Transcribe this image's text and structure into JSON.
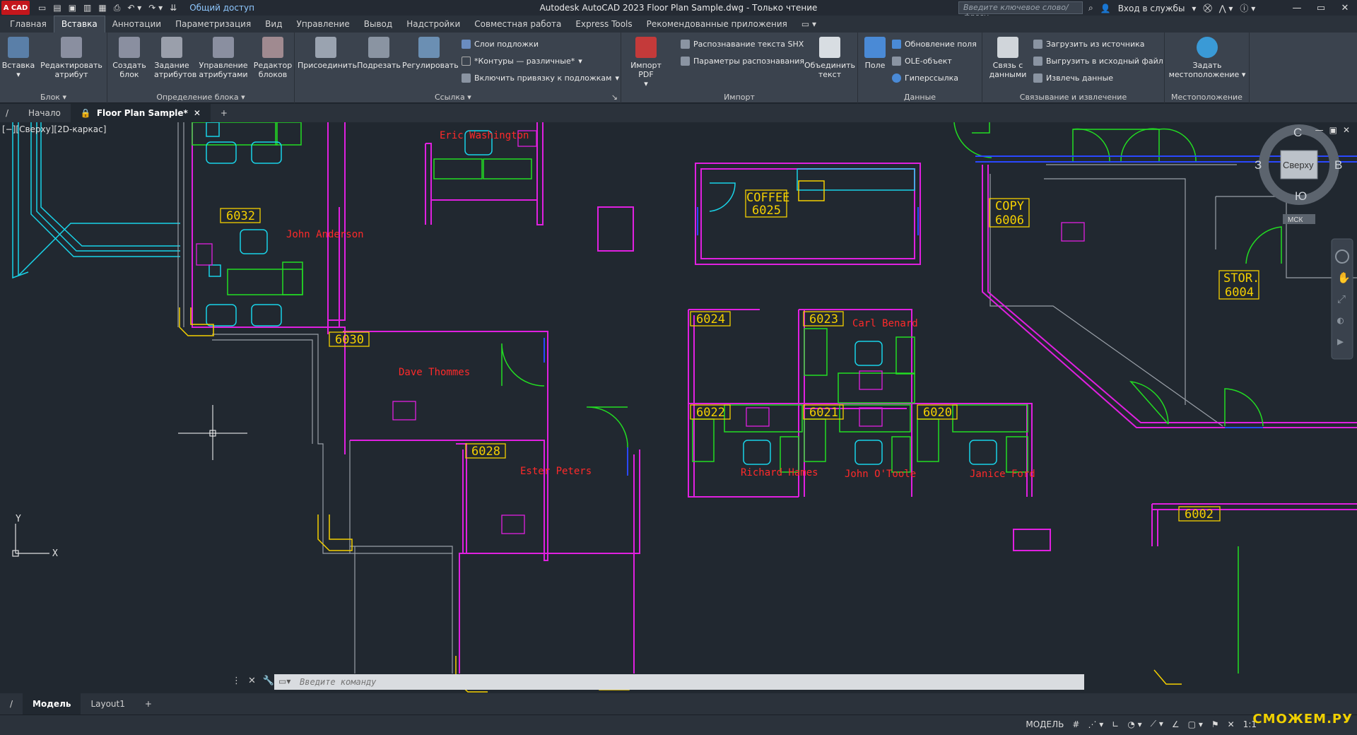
{
  "titlebar": {
    "logo": "A CAD",
    "share": "Общий доступ",
    "title": "Autodesk AutoCAD 2023    Floor Plan Sample.dwg - Только чтение",
    "search_placeholder": "Введите ключевое слово/фразу",
    "signin": "Вход в службы"
  },
  "ribbon_tabs": [
    "Главная",
    "Вставка",
    "Аннотации",
    "Параметризация",
    "Вид",
    "Управление",
    "Вывод",
    "Надстройки",
    "Совместная работа",
    "Express Tools",
    "Рекомендованные приложения"
  ],
  "active_tab": "Вставка",
  "ribbon": {
    "block_panel": {
      "title": "Блок",
      "insert": "Вставка",
      "edit_attr": "Редактировать атрибут"
    },
    "blockdef_panel": {
      "title": "Определение блока",
      "create": "Создать блок",
      "define_attr": "Задание атрибутов",
      "manage_attr": "Управление атрибутами",
      "block_editor": "Редактор блоков"
    },
    "reference_panel": {
      "title": "Ссылка",
      "attach": "Присоединить",
      "clip": "Подрезать",
      "adjust": "Регулировать",
      "underlay_layers": "Слои подложки",
      "frames": "*Контуры — различные*",
      "snap_underlay": "Включить привязку к подложкам"
    },
    "import_panel": {
      "title": "Импорт",
      "import_pdf": "Импорт PDF",
      "recognize_shx": "Распознавание текста SHX",
      "recognize_params": "Параметры распознавания",
      "combine_text": "Объединить текст"
    },
    "data_panel": {
      "title": "Данные",
      "field": "Поле",
      "update_fields": "Обновление поля",
      "ole": "OLE-объект",
      "hyperlink": "Гиперссылка"
    },
    "link_panel": {
      "title": "Связывание и извлечение",
      "data_link": "Связь с данными",
      "load_source": "Загрузить из источника",
      "upload_source": "Выгрузить в исходный файл",
      "extract": "Извлечь  данные"
    },
    "location_panel": {
      "title": "Местоположение",
      "set_location": "Задать местоположение"
    }
  },
  "doc_tabs": {
    "start": "Начало",
    "current": "Floor Plan Sample*"
  },
  "viewport": {
    "label": "[−][Сверху][2D-каркас]"
  },
  "viewcube": {
    "north": "С",
    "south": "Ю",
    "west": "З",
    "east": "В",
    "face": "Сверху",
    "ucs": "МСК"
  },
  "rooms": [
    {
      "label": "6032"
    },
    {
      "label": "6030"
    },
    {
      "label": "6028"
    },
    {
      "label": "6025",
      "name": "COFFEE"
    },
    {
      "label": "6024"
    },
    {
      "label": "6023"
    },
    {
      "label": "6022"
    },
    {
      "label": "6021"
    },
    {
      "label": "6020"
    },
    {
      "label": "6006",
      "name": "COPY"
    },
    {
      "label": "6004",
      "name": "STOR."
    },
    {
      "label": "6002"
    }
  ],
  "occupants": [
    "Eric Washington",
    "John Anderson",
    "Dave Thommes",
    "Ester Peters",
    "Carl Benard",
    "Richard Hames",
    "John O'Toole",
    "Janice Ford"
  ],
  "command": {
    "placeholder": "Введите команду"
  },
  "layout_tabs": [
    "Модель",
    "Layout1"
  ],
  "status": {
    "model": "МОДЕЛЬ",
    "scale": "1:1"
  },
  "watermark": "СМОЖЕМ.РУ",
  "colors": {
    "magenta": "#e020e0",
    "cyan": "#19d3e8",
    "green": "#22dd22",
    "yellow": "#f5d000",
    "red": "#ff2a2a",
    "gray": "#9aa0a8"
  }
}
